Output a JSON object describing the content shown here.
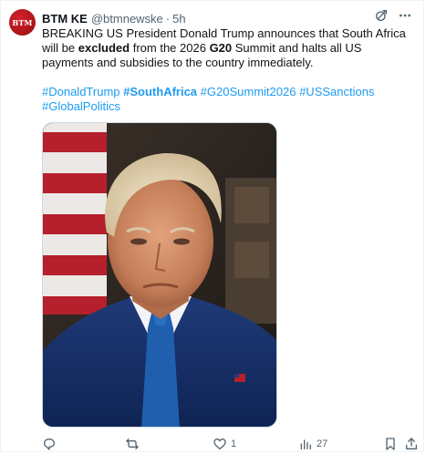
{
  "author": {
    "avatar_text": "BTM",
    "name": "BTM KE",
    "handle": "@btmnewske",
    "separator": "·",
    "time": "5h"
  },
  "tweet": {
    "text_parts": [
      "BREAKING US President Donald Trump announces that South Africa will be ",
      "excluded",
      " from the 2026 ",
      "G20",
      " Summit and halts all US payments and subsidies to the country immediately."
    ],
    "hashtags": [
      {
        "text": "#DonaldTrump",
        "bold": false
      },
      {
        "text": "#SouthAfrica",
        "bold": true
      },
      {
        "text": "#G20Summit2026",
        "bold": false
      },
      {
        "text": "#USSanctions",
        "bold": false
      },
      {
        "text": "#GlobalPolitics",
        "bold": false
      }
    ]
  },
  "actions": {
    "reply_count": "",
    "retweet_count": "",
    "like_count": "1",
    "views_count": "27"
  },
  "icons": {
    "grok": "grok-icon",
    "more": "more-icon",
    "reply": "reply-icon",
    "retweet": "retweet-icon",
    "like": "heart-icon",
    "views": "views-icon",
    "bookmark": "bookmark-icon",
    "share": "share-icon"
  },
  "colors": {
    "accent": "#1d9bf0",
    "muted": "#536471",
    "avatar_red": "#c8151c"
  }
}
